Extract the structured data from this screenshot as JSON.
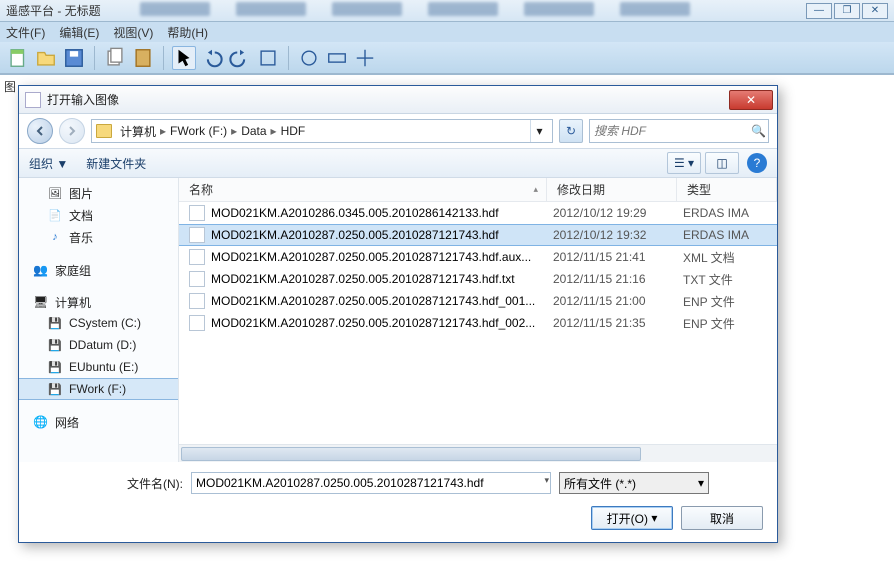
{
  "main_window": {
    "title": "遥感平台 - 无标题",
    "menu": [
      "文件(F)",
      "编辑(E)",
      "视图(V)",
      "帮助(H)"
    ]
  },
  "dialog": {
    "title": "打开输入图像",
    "breadcrumb": [
      "计算机",
      "FWork (F:)",
      "Data",
      "HDF"
    ],
    "search_placeholder": "搜索 HDF",
    "toolbar": {
      "organize": "组织 ▼",
      "new_folder": "新建文件夹"
    },
    "columns": {
      "name": "名称",
      "modified": "修改日期",
      "type": "类型"
    },
    "sidebar": {
      "libs": [
        {
          "label": "图片",
          "icon": "🖼"
        },
        {
          "label": "文档",
          "icon": "📄"
        },
        {
          "label": "音乐",
          "icon": "♪"
        }
      ],
      "homegroup": "家庭组",
      "computer": "计算机",
      "drives": [
        {
          "label": "CSystem (C:)"
        },
        {
          "label": "DDatum (D:)"
        },
        {
          "label": "EUbuntu (E:)"
        },
        {
          "label": "FWork (F:)",
          "selected": true
        }
      ],
      "network": "网络"
    },
    "files": [
      {
        "name": "MOD021KM.A2010286.0345.005.2010286142133.hdf",
        "date": "2012/10/12 19:29",
        "type": "ERDAS IMA"
      },
      {
        "name": "MOD021KM.A2010287.0250.005.2010287121743.hdf",
        "date": "2012/10/12 19:32",
        "type": "ERDAS IMA",
        "selected": true
      },
      {
        "name": "MOD021KM.A2010287.0250.005.2010287121743.hdf.aux...",
        "date": "2012/11/15 21:41",
        "type": "XML 文档"
      },
      {
        "name": "MOD021KM.A2010287.0250.005.2010287121743.hdf.txt",
        "date": "2012/11/15 21:16",
        "type": "TXT 文件"
      },
      {
        "name": "MOD021KM.A2010287.0250.005.2010287121743.hdf_001...",
        "date": "2012/11/15 21:00",
        "type": "ENP 文件"
      },
      {
        "name": "MOD021KM.A2010287.0250.005.2010287121743.hdf_002...",
        "date": "2012/11/15 21:35",
        "type": "ENP 文件"
      }
    ],
    "filename_label": "文件名(N):",
    "filename_value": "MOD021KM.A2010287.0250.005.2010287121743.hdf",
    "filetype": "所有文件 (*.*)",
    "open_btn": "打开(O)",
    "cancel_btn": "取消"
  }
}
